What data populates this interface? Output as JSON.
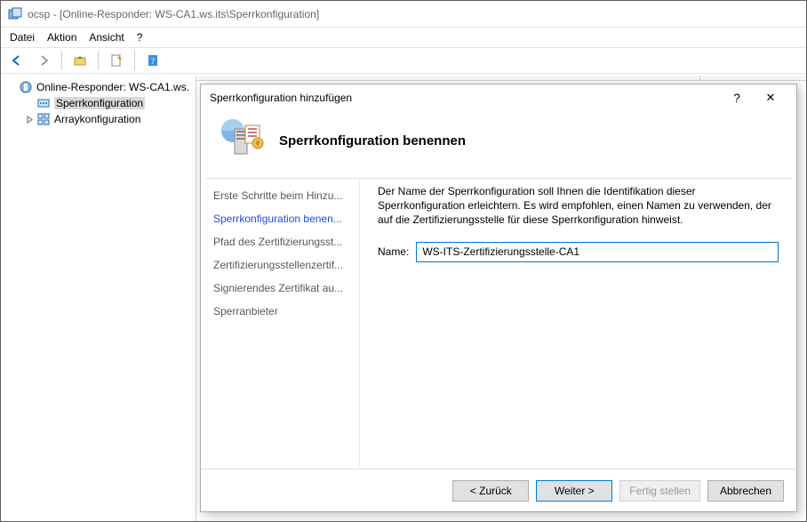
{
  "titlebar": {
    "app": "ocsp",
    "context": "[Online-Responder: WS-CA1.ws.its\\Sperrkonfiguration]"
  },
  "menu": {
    "file": "Datei",
    "action": "Aktion",
    "view": "Ansicht",
    "help": "?"
  },
  "tree": {
    "root": "Online-Responder: WS-CA1.ws.",
    "n1": "Sperrkonfiguration",
    "n2": "Arraykonfiguration"
  },
  "dialog": {
    "title": "Sperrkonfiguration hinzufügen",
    "help_glyph": "?",
    "close_glyph": "✕",
    "heading": "Sperrkonfiguration benennen",
    "steps": {
      "s1": "Erste Schritte beim Hinzu...",
      "s2": "Sperrkonfiguration benen...",
      "s3": "Pfad des Zertifizierungsst...",
      "s4": "Zertifizierungsstellenzertif...",
      "s5": "Signierendes Zertifikat au...",
      "s6": "Sperranbieter"
    },
    "desc": "Der Name der Sperrkonfiguration soll Ihnen die Identifikation dieser Sperrkonfiguration erleichtern. Es wird empfohlen, einen Namen zu verwenden, der auf die Zertifizierungsstelle für diese Sperrkonfiguration hinweist.",
    "name_label": "Name:",
    "name_value": "WS-ITS-Zertifizierungsstelle-CA1",
    "buttons": {
      "back": "< Zurück",
      "next": "Weiter >",
      "finish": "Fertig stellen",
      "cancel": "Abbrechen"
    }
  }
}
